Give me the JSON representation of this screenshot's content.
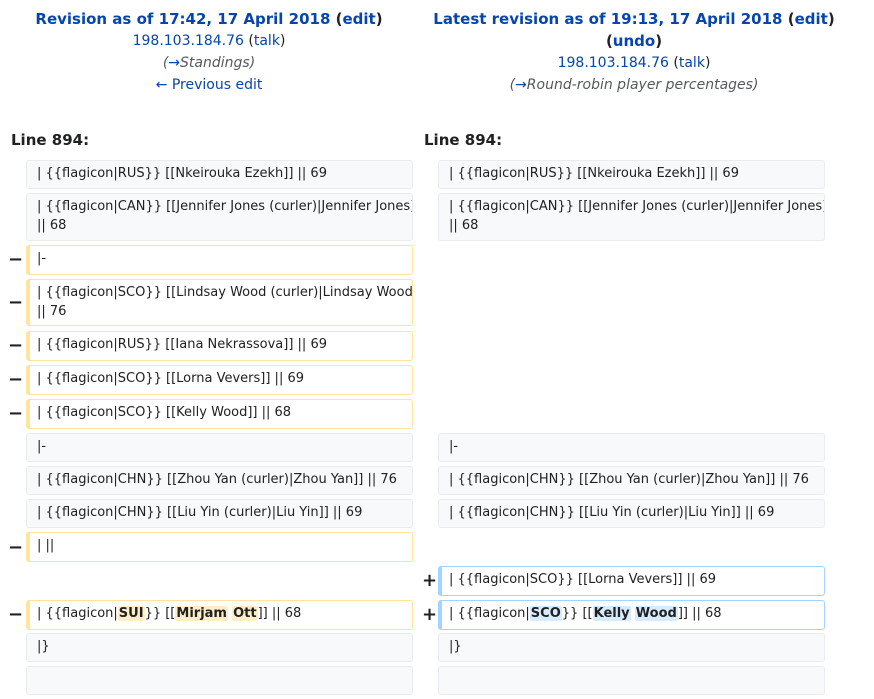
{
  "header": {
    "left": {
      "title_prefix": "Revision as of 17:42, 17 April 2018",
      "edit": "edit",
      "user": "198.103.184.76",
      "talk": "talk",
      "comment_section": "Standings",
      "prev_edit": "← Previous edit"
    },
    "right": {
      "title_prefix": "Latest revision as of 19:13, 17 April 2018",
      "edit": "edit",
      "undo": "undo",
      "user": "198.103.184.76",
      "talk": "talk",
      "comment_section": "Round-robin player percentages"
    }
  },
  "punct": {
    "open_paren": "(",
    "close_paren": ")",
    "arrow": "→"
  },
  "line_numbers": {
    "left": "Line 894:",
    "right": "Line 894:"
  },
  "marks": {
    "minus": "−",
    "plus": "+"
  },
  "rows": {
    "r1": "| {{flagicon|RUS}} [[Nkeirouka Ezekh]] || 69",
    "r2a": "| {{flagicon|CAN}} [[Jennifer Jones (curler)|Jennifer Jones]]",
    "r2b": "|| 68",
    "d1": "|-",
    "d2a": "| {{flagicon|SCO}} [[Lindsay Wood (curler)|Lindsay Wood]]",
    "d2b": "|| 76",
    "d3": "| {{flagicon|RUS}} [[Iana Nekrassova]] || 69",
    "d4": "| {{flagicon|SCO}} [[Lorna Vevers]] || 69",
    "d5": "| {{flagicon|SCO}} [[Kelly Wood]] || 68",
    "c1": "|-",
    "c2": "| {{flagicon|CHN}} [[Zhou Yan (curler)|Zhou Yan]] || 76",
    "c3": "| {{flagicon|CHN}} [[Liu Yin (curler)|Liu Yin]] || 69",
    "d6": "| ||",
    "a1": "| {{flagicon|SCO}} [[Lorna Vevers]] || 69",
    "changed": {
      "pre": "| {{flagicon|",
      "mid": "}} [[",
      "post": "]] || 68",
      "old_flag": "SUI",
      "old_first": "Mirjam",
      "old_last": "Ott",
      "new_flag": "SCO",
      "new_first": "Kelly",
      "new_last": "Wood"
    },
    "end": "|}"
  }
}
